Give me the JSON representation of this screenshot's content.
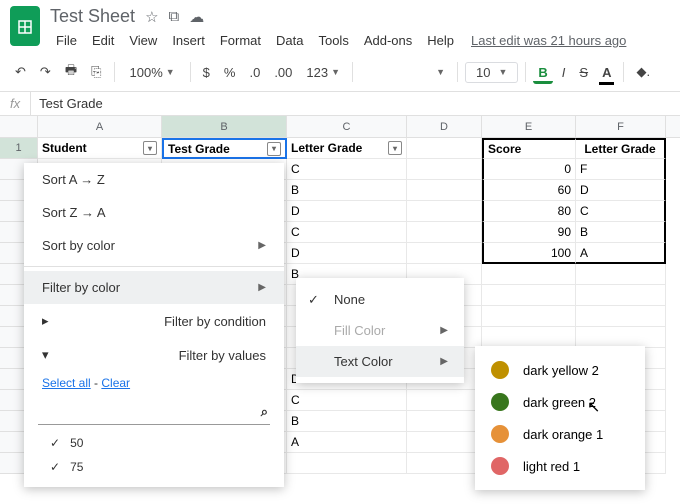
{
  "doc_title": "Test Sheet",
  "menus": [
    "File",
    "Edit",
    "View",
    "Insert",
    "Format",
    "Data",
    "Tools",
    "Add-ons",
    "Help"
  ],
  "last_edit": "Last edit was 21 hours ago",
  "toolbar": {
    "zoom": "100%",
    "font_size": "10",
    "currency": "$",
    "percent": "%",
    "dec1": ".0",
    "dec2": ".00",
    "fmt": "123"
  },
  "fx": "Test Grade",
  "cols": [
    "A",
    "B",
    "C",
    "D",
    "E",
    "F"
  ],
  "header_row": {
    "A": "Student",
    "B": "Test Grade",
    "C": "Letter Grade",
    "E": "Score",
    "F": "Letter Grade"
  },
  "grades": [
    "C",
    "B",
    "D",
    "C",
    "D",
    "B"
  ],
  "grades2": [
    "D",
    "C",
    "B",
    "A"
  ],
  "scale": [
    {
      "s": "0",
      "g": "F"
    },
    {
      "s": "60",
      "g": "D"
    },
    {
      "s": "80",
      "g": "C"
    },
    {
      "s": "90",
      "g": "B"
    },
    {
      "s": "100",
      "g": "A"
    }
  ],
  "filter_menu": {
    "sort_az": "Sort A → Z",
    "sort_za": "Sort Z → A",
    "sort_color": "Sort by color",
    "filter_color": "Filter by color",
    "filter_cond": "Filter by condition",
    "filter_vals": "Filter by values",
    "select_all": "Select all",
    "clear": "Clear",
    "vals": [
      "50",
      "75"
    ]
  },
  "sub_menu": {
    "none": "None",
    "fill": "Fill Color",
    "text": "Text Color"
  },
  "colors": [
    {
      "name": "dark yellow 2",
      "hex": "#bf9000"
    },
    {
      "name": "dark green 2",
      "hex": "#38761d"
    },
    {
      "name": "dark orange 1",
      "hex": "#e69138"
    },
    {
      "name": "light red 1",
      "hex": "#e06666"
    }
  ]
}
